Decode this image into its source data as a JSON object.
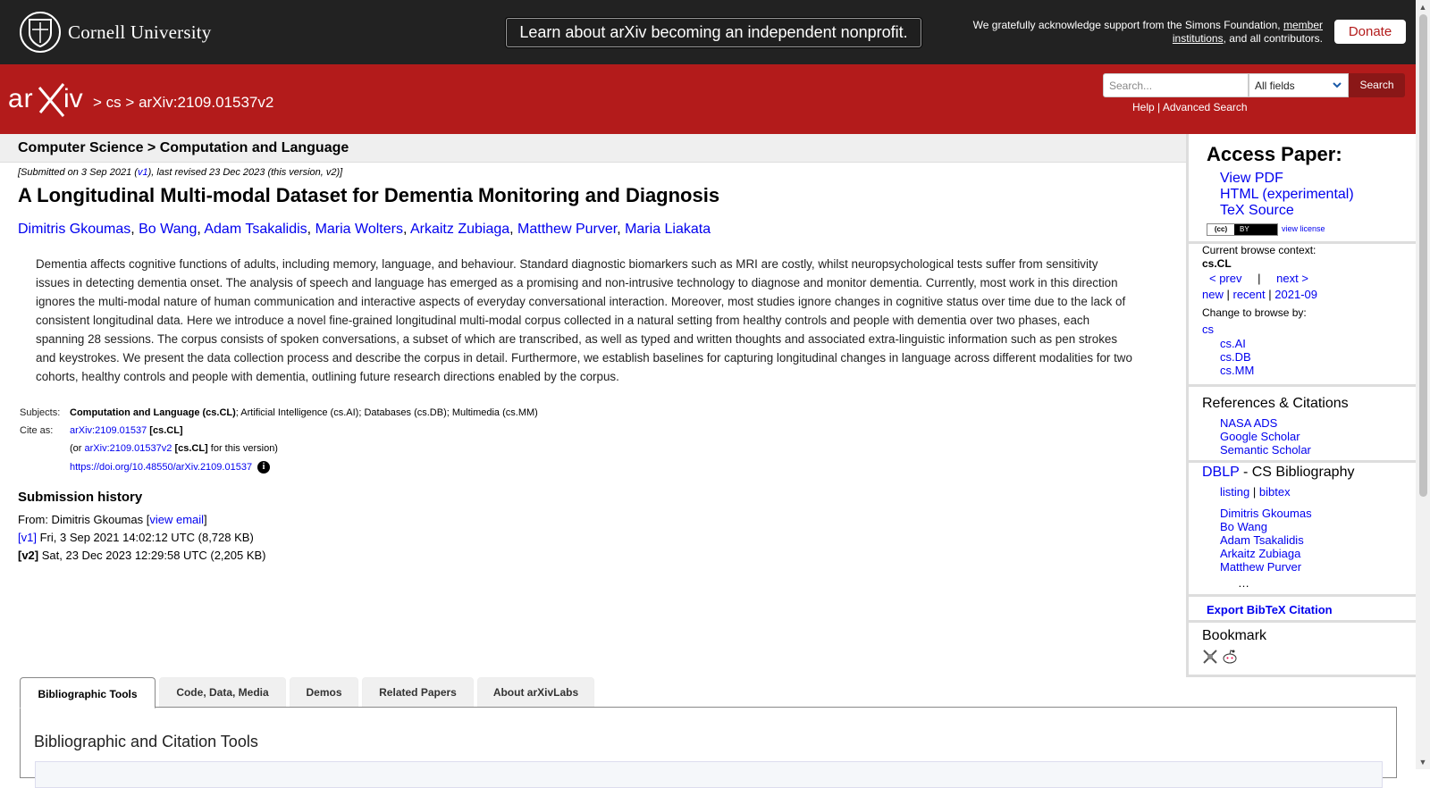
{
  "banner": {
    "university": "Cornell University",
    "announcement": "Learn about arXiv becoming an independent nonprofit.",
    "support_prefix": "We gratefully acknowledge support from the Simons Foundation,",
    "support_link": "member institutions",
    "support_suffix": ", and all contributors.",
    "donate_label": "Donate"
  },
  "header": {
    "logo_text": "arXiv",
    "crumb_sep1": ">",
    "crumb_cs": "cs",
    "crumb_sep2": ">",
    "crumb_id": "arXiv:2109.01537v2",
    "search_placeholder": "Search...",
    "search_field": "All fields",
    "search_button": "Search",
    "help_link": "Help",
    "help_sep": "|",
    "advanced_link": "Advanced Search"
  },
  "paper": {
    "subject_heading": "Computer Science > Computation and Language",
    "date_prefix": "[Submitted on 3 Sep 2021 (",
    "date_v1": "v1",
    "date_suffix": "), last revised 23 Dec 2023 (this version, v2)]",
    "title": "A Longitudinal Multi-modal Dataset for Dementia Monitoring and Diagnosis",
    "authors": [
      "Dimitris Gkoumas",
      "Bo Wang",
      "Adam Tsakalidis",
      "Maria Wolters",
      "Arkaitz Zubiaga",
      "Matthew Purver",
      "Maria Liakata"
    ],
    "abstract_lines": [
      "Dementia affects cognitive functions of adults, including memory, language, and behaviour. Standard diagnostic biomarkers such as MRI are costly, whilst neuropsychological tests suffer from sensitivity",
      "issues in detecting dementia onset. The analysis of speech and language has emerged as a promising and non-intrusive technology to diagnose and monitor dementia. Currently, most work in this direction",
      "ignores the multi-modal nature of human communication and interactive aspects of everyday conversational interaction. Moreover, most studies ignore changes in cognitive status over time due to the lack of",
      "consistent longitudinal data. Here we introduce a novel fine-grained longitudinal multi-modal corpus collected in a natural setting from healthy controls and people with dementia over two phases, each",
      "spanning 28 sessions. The corpus consists of spoken conversations, a subset of which are transcribed, as well as typed and written thoughts and associated extra-linguistic information such as pen strokes",
      "and keystrokes. We present the data collection process and describe the corpus in detail. Furthermore, we establish baselines for capturing longitudinal changes in language across different modalities for two",
      "cohorts, healthy controls and people with dementia, outlining future research directions enabled by the corpus."
    ],
    "subjects_label": "Subjects:",
    "subjects_primary": "Computation and Language (cs.CL)",
    "subjects_rest": "; Artificial Intelligence (cs.AI); Databases (cs.DB); Multimedia (cs.MM)",
    "cite_label": "Cite as:",
    "cite_id": "arXiv:2109.01537",
    "cite_cat": "[cs.CL]",
    "cite2_prefix": "(or",
    "cite2_id": "arXiv:2109.01537v2",
    "cite2_cat": "[cs.CL]",
    "cite2_suffix": "for this version)",
    "doi": "https://doi.org/10.48550/arXiv.2109.01537",
    "info_glyph": "i",
    "history_heading": "Submission history",
    "history_from_prefix": "From: Dimitris Gkoumas [",
    "history_from_link": "view email",
    "history_from_suffix": "]",
    "v1_label": "[v1]",
    "v1_text": "Fri, 3 Sep 2021 14:02:12 UTC (8,728 KB)",
    "v2_label": "[v2]",
    "v2_text": "Sat, 23 Dec 2023 12:29:58 UTC (2,205 KB)"
  },
  "tabs": [
    {
      "label": "Bibliographic Tools",
      "active": true
    },
    {
      "label": "Code, Data, Media",
      "active": false
    },
    {
      "label": "Demos",
      "active": false
    },
    {
      "label": "Related Papers",
      "active": false
    },
    {
      "label": "About arXivLabs",
      "active": false
    }
  ],
  "tab_panel_heading": "Bibliographic and Citation Tools",
  "sidebar": {
    "access_heading": "Access Paper:",
    "access_links": [
      "View PDF",
      "HTML (experimental)",
      "TeX Source"
    ],
    "cc_left": "(cc)",
    "cc_right": "BY",
    "view_license": "view license",
    "browse_context_label": "Current browse context:",
    "browse_context": "cs.CL",
    "prev": "< prev",
    "nav_sep": "|",
    "next": "next >",
    "new": "new",
    "recent": "recent",
    "month": "2021-09",
    "change_browse": "Change to browse by:",
    "browse_cs": "cs",
    "browse_cats": [
      "cs.AI",
      "cs.DB",
      "cs.MM"
    ],
    "refs_heading": "References & Citations",
    "refs_links": [
      "NASA ADS",
      "Google Scholar",
      "Semantic Scholar"
    ],
    "dblp_link": "DBLP",
    "dblp_rest": " - CS Bibliography",
    "dblp_listing": "listing",
    "dblp_bibtex": "bibtex",
    "dblp_authors": [
      "Dimitris Gkoumas",
      "Bo Wang",
      "Adam Tsakalidis",
      "Arkaitz Zubiaga",
      "Matthew Purver"
    ],
    "dblp_more": "…",
    "export_bibtex": "Export BibTeX Citation",
    "bookmark_heading": "Bookmark"
  },
  "colors": {
    "arxiv_red": "#b31b1b",
    "banner_black": "#222222",
    "link_blue": "#0000ee"
  }
}
